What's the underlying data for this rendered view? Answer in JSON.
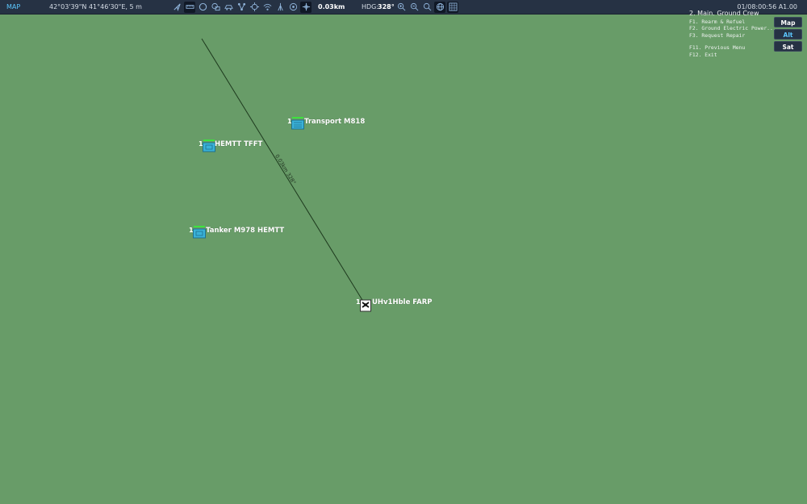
{
  "topbar": {
    "mode": "MAP",
    "coordinates": "42°03'39\"N 41°46'30\"E, 5 m",
    "distance": "0.03km",
    "heading_label": "HDG:",
    "heading_value": "328°",
    "datetime": "01/08:00:56 A1.00",
    "tools": [
      "cursor-icon",
      "ruler-icon",
      "circle-icon",
      "units-icon",
      "vehicle-icon",
      "nodes-icon",
      "crosshair-icon",
      "wifi-icon",
      "tower-icon",
      "globe-pin-icon",
      "move-icon"
    ],
    "zooms": [
      "zoom-in-icon",
      "zoom-out-icon",
      "zoom-reset-icon",
      "globe-icon",
      "grid-icon"
    ]
  },
  "menu": {
    "title": "2. Main. Ground Crew",
    "items": [
      "F1. Rearm & Refuel",
      "F2. Ground Electric Power...",
      "F3. Request Repair"
    ],
    "footer": [
      "F11. Previous Menu",
      "F12. Exit"
    ]
  },
  "layers": [
    "Map",
    "Alt",
    "Sat"
  ],
  "units": [
    {
      "count": "1",
      "name": "Transport M818"
    },
    {
      "count": "1",
      "name": "HEMTT TFFT"
    },
    {
      "count": "1",
      "name": "Tanker M978 HEMTT"
    },
    {
      "count": "1",
      "name": "UHv1Hble FARP"
    }
  ],
  "measure": {
    "text": "0.03km 328°"
  },
  "colors": {
    "map_bg": "#689c68",
    "bar_bg": "#263244",
    "accent": "#5cc8ff",
    "unit_health": "#3ee23e",
    "unit_fill": "#3ab2d8"
  }
}
